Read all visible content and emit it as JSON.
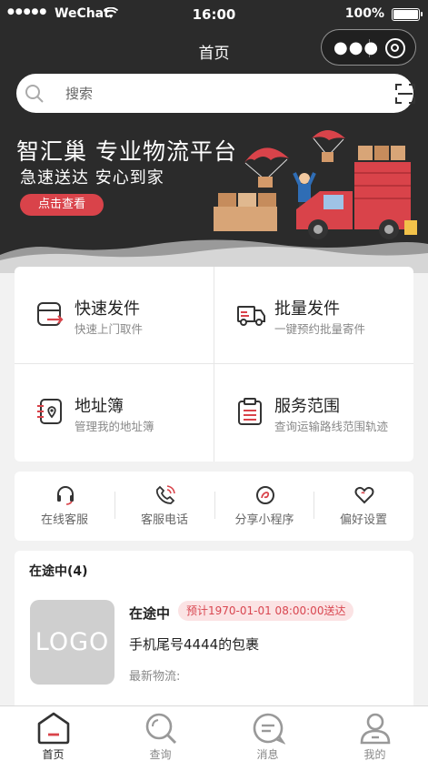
{
  "status_bar": {
    "carrier": "WeChat",
    "time": "16:00",
    "battery": "100%"
  },
  "nav": {
    "title": "首页"
  },
  "search": {
    "placeholder": "搜索"
  },
  "banner": {
    "title": "智汇巢 专业物流平台",
    "subtitle": "急速送达 安心到家",
    "button": "点击查看"
  },
  "services": [
    {
      "title": "快速发件",
      "desc": "快速上门取件",
      "icon": "fast-send-icon"
    },
    {
      "title": "批量发件",
      "desc": "一键预约批量寄件",
      "icon": "truck-icon"
    },
    {
      "title": "地址簿",
      "desc": "管理我的地址簿",
      "icon": "address-book-icon"
    },
    {
      "title": "服务范围",
      "desc": "查询运输路线范围轨迹",
      "icon": "clipboard-icon"
    }
  ],
  "quick_links": [
    {
      "label": "在线客服",
      "icon": "headset-icon"
    },
    {
      "label": "客服电话",
      "icon": "phone-icon"
    },
    {
      "label": "分享小程序",
      "icon": "share-icon"
    },
    {
      "label": "偏好设置",
      "icon": "heart-icon"
    }
  ],
  "transit": {
    "header": "在途中(4)",
    "logo_text": "LOGO",
    "status": "在途中",
    "eta": "预计1970-01-01 08:00:00送达",
    "package_name": "手机尾号4444的包裹",
    "logistics_label": "最新物流:"
  },
  "tabbar": [
    {
      "label": "首页",
      "icon": "home-icon",
      "active": true
    },
    {
      "label": "查询",
      "icon": "search-icon",
      "active": false
    },
    {
      "label": "消息",
      "icon": "message-icon",
      "active": false
    },
    {
      "label": "我的",
      "icon": "user-icon",
      "active": false
    }
  ],
  "colors": {
    "accent": "#d9434a",
    "header_bg": "#2b2b2b",
    "eta_bg": "#fbe3e4"
  }
}
